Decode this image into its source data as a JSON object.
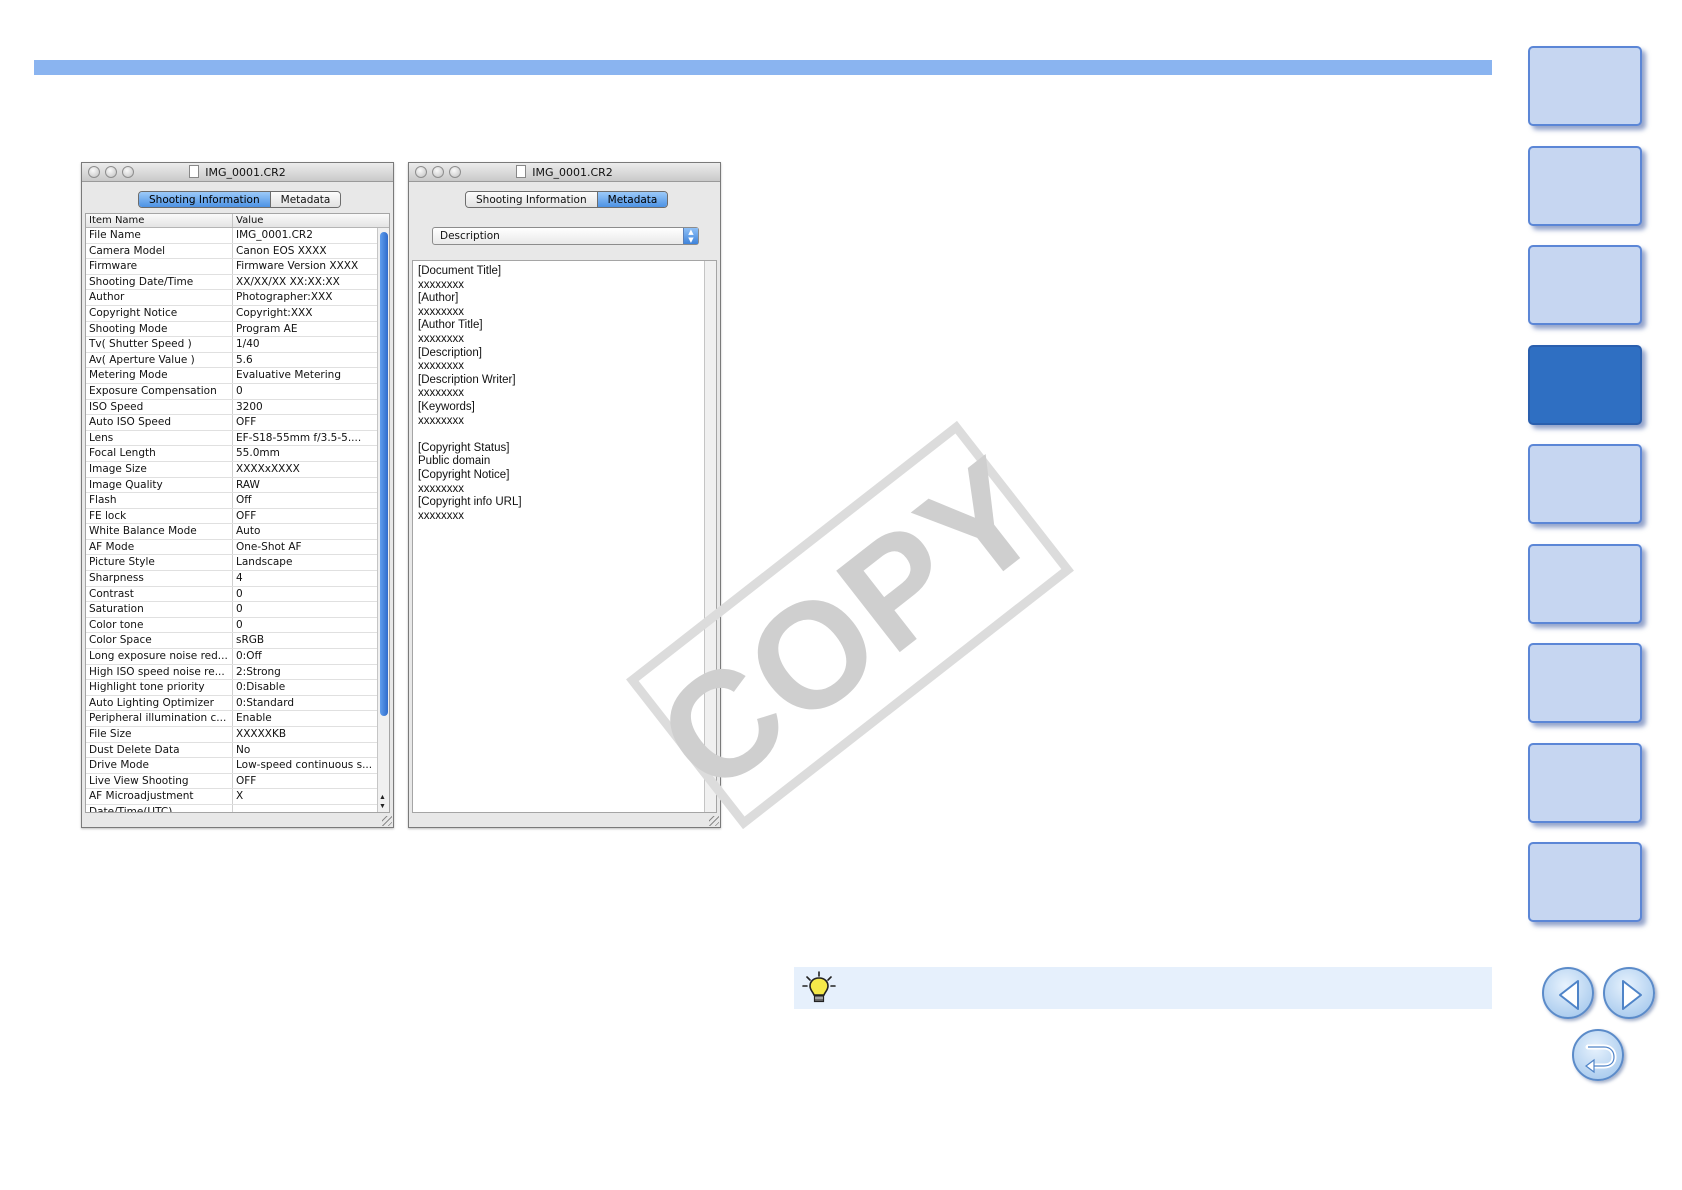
{
  "left_window": {
    "title": "IMG_0001.CR2",
    "tabs": [
      "Shooting Information",
      "Metadata"
    ],
    "active_tab": 0,
    "columns": [
      "Item Name",
      "Value"
    ],
    "rows": [
      [
        "File Name",
        "IMG_0001.CR2"
      ],
      [
        "Camera Model",
        "Canon EOS XXXX"
      ],
      [
        "Firmware",
        "Firmware Version XXXX"
      ],
      [
        "Shooting Date/Time",
        "XX/XX/XX XX:XX:XX"
      ],
      [
        "Author",
        "Photographer:XXX"
      ],
      [
        "Copyright Notice",
        "Copyright:XXX"
      ],
      [
        "Shooting Mode",
        "Program AE"
      ],
      [
        "Tv( Shutter Speed )",
        "1/40"
      ],
      [
        "Av( Aperture Value )",
        "5.6"
      ],
      [
        "Metering Mode",
        "Evaluative Metering"
      ],
      [
        "Exposure Compensation",
        "0"
      ],
      [
        "ISO Speed",
        "3200"
      ],
      [
        "Auto ISO Speed",
        "OFF"
      ],
      [
        "Lens",
        "EF-S18-55mm f/3.5-5...."
      ],
      [
        "Focal Length",
        "55.0mm"
      ],
      [
        "Image Size",
        "XXXXxXXXX"
      ],
      [
        "Image Quality",
        "RAW"
      ],
      [
        "Flash",
        "Off"
      ],
      [
        "FE lock",
        "OFF"
      ],
      [
        "White Balance Mode",
        "Auto"
      ],
      [
        "AF Mode",
        "One-Shot AF"
      ],
      [
        "Picture Style",
        "Landscape"
      ],
      [
        "Sharpness",
        "4"
      ],
      [
        "Contrast",
        "0"
      ],
      [
        "Saturation",
        "0"
      ],
      [
        "Color tone",
        "0"
      ],
      [
        "Color Space",
        "sRGB"
      ],
      [
        "Long exposure noise red...",
        "0:Off"
      ],
      [
        "High ISO speed noise re...",
        "2:Strong"
      ],
      [
        "Highlight tone priority",
        "0:Disable"
      ],
      [
        "Auto Lighting Optimizer",
        "0:Standard"
      ],
      [
        "Peripheral illumination c...",
        "Enable"
      ],
      [
        "File Size",
        "XXXXXKB"
      ],
      [
        "Dust Delete Data",
        "No"
      ],
      [
        "Drive Mode",
        "Low-speed continuous s..."
      ],
      [
        "Live View Shooting",
        "OFF"
      ],
      [
        "AF Microadjustment",
        "X"
      ],
      [
        "Date/Time(UTC)",
        ""
      ]
    ]
  },
  "right_window": {
    "title": "IMG_0001.CR2",
    "tabs": [
      "Shooting Information",
      "Metadata"
    ],
    "active_tab": 1,
    "dropdown_value": "Description",
    "lines": [
      "[Document Title]",
      "xxxxxxxx",
      "[Author]",
      "xxxxxxxx",
      "[Author Title]",
      "xxxxxxxx",
      "[Description]",
      "xxxxxxxx",
      "[Description Writer]",
      "xxxxxxxx",
      "[Keywords]",
      "xxxxxxxx",
      "",
      "[Copyright Status]",
      "Public domain",
      "[Copyright Notice]",
      "xxxxxxxx",
      "[Copyright info URL]",
      "xxxxxxxx"
    ]
  },
  "watermark": "COPY",
  "colors": {
    "top_bar": "#8ab4f0",
    "side_tab": "#c6d6f1",
    "side_tab_active": "#2f6fc2",
    "hint_bar": "#e6f0fc"
  },
  "side_tabs": {
    "count": 9,
    "active_index": 3
  },
  "icons": {
    "hint": "lightbulb-icon",
    "prev": "arrow-left-icon",
    "next": "arrow-right-icon",
    "back": "return-icon"
  }
}
